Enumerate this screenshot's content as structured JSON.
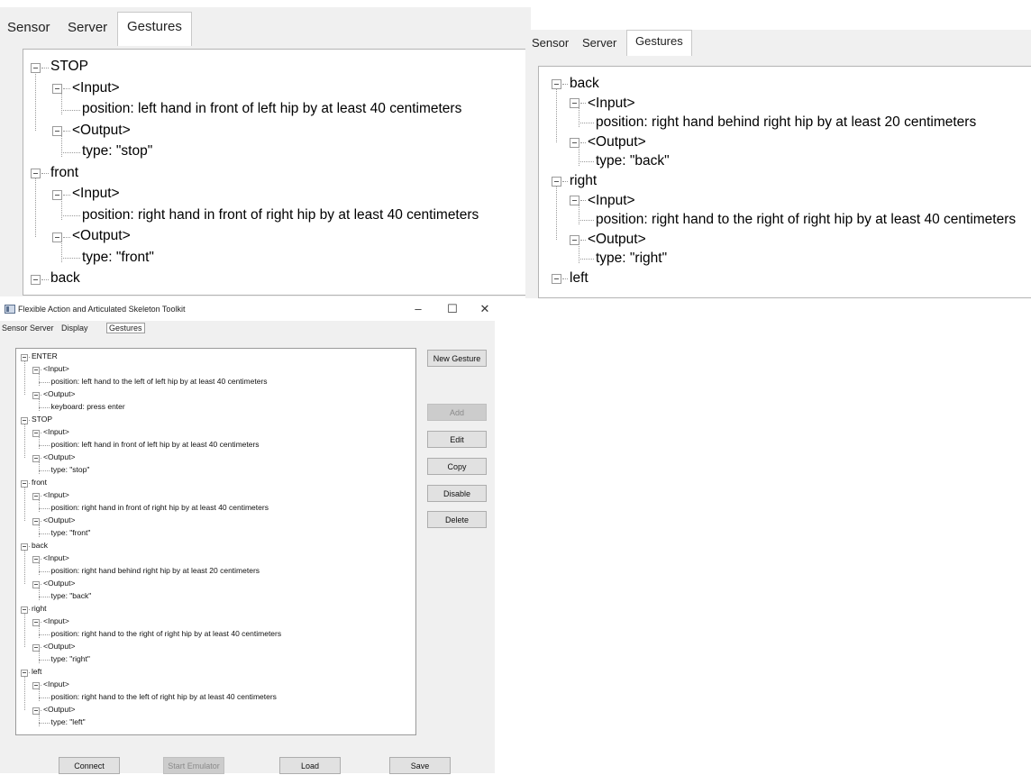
{
  "zoom_left": {
    "tabs": [
      "Sensor",
      "Server",
      "Gestures"
    ],
    "active_tab": "Gestures",
    "rows": [
      {
        "level": 0,
        "text": "STOP"
      },
      {
        "level": 1,
        "text": "<Input>"
      },
      {
        "level": 2,
        "text": "position: left hand in front of left hip by at least 40 centimeters"
      },
      {
        "level": 1,
        "text": "<Output>"
      },
      {
        "level": 2,
        "text": "type: \"stop\""
      },
      {
        "level": 0,
        "text": "front"
      },
      {
        "level": 1,
        "text": "<Input>"
      },
      {
        "level": 2,
        "text": "position: right hand in front of right hip by at least 40 centimeters"
      },
      {
        "level": 1,
        "text": "<Output>"
      },
      {
        "level": 2,
        "text": "type: \"front\""
      },
      {
        "level": 0,
        "text": "back"
      }
    ]
  },
  "zoom_right": {
    "tabs": [
      "Sensor",
      "Server",
      "Gestures"
    ],
    "active_tab": "Gestures",
    "rows": [
      {
        "level": 0,
        "text": "back"
      },
      {
        "level": 1,
        "text": "<Input>"
      },
      {
        "level": 2,
        "text": "position: right hand behind right hip by at least 20 centimeters"
      },
      {
        "level": 1,
        "text": "<Output>"
      },
      {
        "level": 2,
        "text": "type: \"back\""
      },
      {
        "level": 0,
        "text": "right"
      },
      {
        "level": 1,
        "text": "<Input>"
      },
      {
        "level": 2,
        "text": "position: right hand to the right of right hip by at least 40 centimeters"
      },
      {
        "level": 1,
        "text": "<Output>"
      },
      {
        "level": 2,
        "text": "type: \"right\""
      },
      {
        "level": 0,
        "text": "left"
      }
    ]
  },
  "app": {
    "title": "Flexible Action and Articulated Skeleton Toolkit",
    "controls": {
      "minimize": "–",
      "maximize": "☐",
      "close": "✕"
    },
    "tabs": [
      "Sensor",
      "Server",
      "Display",
      "Gestures"
    ],
    "active_tab": "Gestures",
    "tree": [
      {
        "level": 0,
        "text": "ENTER"
      },
      {
        "level": 1,
        "text": "<Input>"
      },
      {
        "level": 2,
        "text": "position: left hand to the left of left hip by at least 40 centimeters"
      },
      {
        "level": 1,
        "text": "<Output>"
      },
      {
        "level": 2,
        "text": "keyboard: press enter"
      },
      {
        "level": 0,
        "text": "STOP"
      },
      {
        "level": 1,
        "text": "<Input>"
      },
      {
        "level": 2,
        "text": "position: left hand in front of left hip by at least 40 centimeters"
      },
      {
        "level": 1,
        "text": "<Output>"
      },
      {
        "level": 2,
        "text": "type: \"stop\""
      },
      {
        "level": 0,
        "text": "front"
      },
      {
        "level": 1,
        "text": "<Input>"
      },
      {
        "level": 2,
        "text": "position: right hand in front of right hip by at least 40 centimeters"
      },
      {
        "level": 1,
        "text": "<Output>"
      },
      {
        "level": 2,
        "text": "type: \"front\""
      },
      {
        "level": 0,
        "text": "back"
      },
      {
        "level": 1,
        "text": "<Input>"
      },
      {
        "level": 2,
        "text": "position: right hand behind right hip by at least 20 centimeters"
      },
      {
        "level": 1,
        "text": "<Output>"
      },
      {
        "level": 2,
        "text": "type: \"back\""
      },
      {
        "level": 0,
        "text": "right"
      },
      {
        "level": 1,
        "text": "<Input>"
      },
      {
        "level": 2,
        "text": "position: right hand to the right of right hip by at least 40 centimeters"
      },
      {
        "level": 1,
        "text": "<Output>"
      },
      {
        "level": 2,
        "text": "type: \"right\""
      },
      {
        "level": 0,
        "text": "left"
      },
      {
        "level": 1,
        "text": "<Input>"
      },
      {
        "level": 2,
        "text": "position: right hand to the left of right hip by at least 40 centimeters"
      },
      {
        "level": 1,
        "text": "<Output>"
      },
      {
        "level": 2,
        "text": "type: \"left\""
      }
    ],
    "side_buttons": {
      "new_gesture": "New Gesture",
      "add": "Add",
      "edit": "Edit",
      "copy": "Copy",
      "disable": "Disable",
      "delete": "Delete"
    },
    "bottom_buttons": {
      "connect": "Connect",
      "start_emulator": "Start Emulator",
      "load": "Load",
      "save": "Save"
    }
  }
}
